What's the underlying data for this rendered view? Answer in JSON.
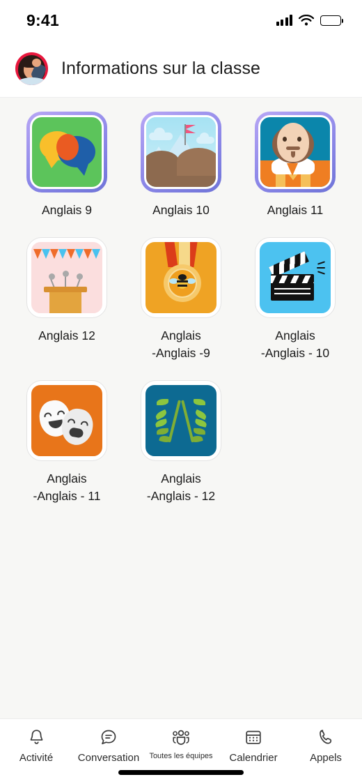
{
  "status_bar": {
    "time": "9:41",
    "icons": [
      "cellular-signal-icon",
      "wifi-icon",
      "battery-icon"
    ]
  },
  "header": {
    "title": "Informations sur la classe",
    "avatar_name": "user-avatar"
  },
  "classes": [
    {
      "name": "Anglais 9",
      "name_line2": "",
      "icon": "speech-bubbles-icon",
      "border": "purple",
      "tile_color": "#5cc45b"
    },
    {
      "name": "Anglais 10",
      "name_line2": "",
      "icon": "mountain-flag-icon",
      "border": "purple",
      "tile_color": "#8fd9ee"
    },
    {
      "name": "Anglais 11",
      "name_line2": "",
      "icon": "shakespeare-icon",
      "border": "purple",
      "tile_color": "#0b86ab"
    },
    {
      "name": "Anglais 12",
      "name_line2": "",
      "icon": "podium-icon",
      "border": "plain",
      "tile_color": "#fbdede"
    },
    {
      "name": "Anglais",
      "name_line2": "-Anglais -9",
      "icon": "spelling-bee-medal-icon",
      "border": "plain",
      "tile_color": "#efa324"
    },
    {
      "name": "Anglais",
      "name_line2": "-Anglais - 10",
      "icon": "clapperboard-icon",
      "border": "plain",
      "tile_color": "#4cc2f0"
    },
    {
      "name": "Anglais",
      "name_line2": "-Anglais - 11",
      "icon": "theater-masks-icon",
      "border": "plain",
      "tile_color": "#e8751a"
    },
    {
      "name": "Anglais",
      "name_line2": "-Anglais - 12",
      "icon": "laurel-wreath-icon",
      "border": "plain",
      "tile_color": "#0d6a92"
    }
  ],
  "bottom_nav": [
    {
      "label": "Activité",
      "icon": "bell-icon"
    },
    {
      "label": "Conversation",
      "icon": "chat-icon"
    },
    {
      "label": "Toutes les équipes",
      "icon": "teams-people-icon"
    },
    {
      "label": "Calendrier",
      "icon": "calendar-icon"
    },
    {
      "label": "Appels",
      "icon": "phone-icon"
    }
  ],
  "colors": {
    "page_background": "#f7f7f5",
    "surface": "#ffffff",
    "text": "#1b1b1b",
    "tile_border_active": "#8d88e8",
    "tile_border_plain": "#e3e3e3"
  }
}
